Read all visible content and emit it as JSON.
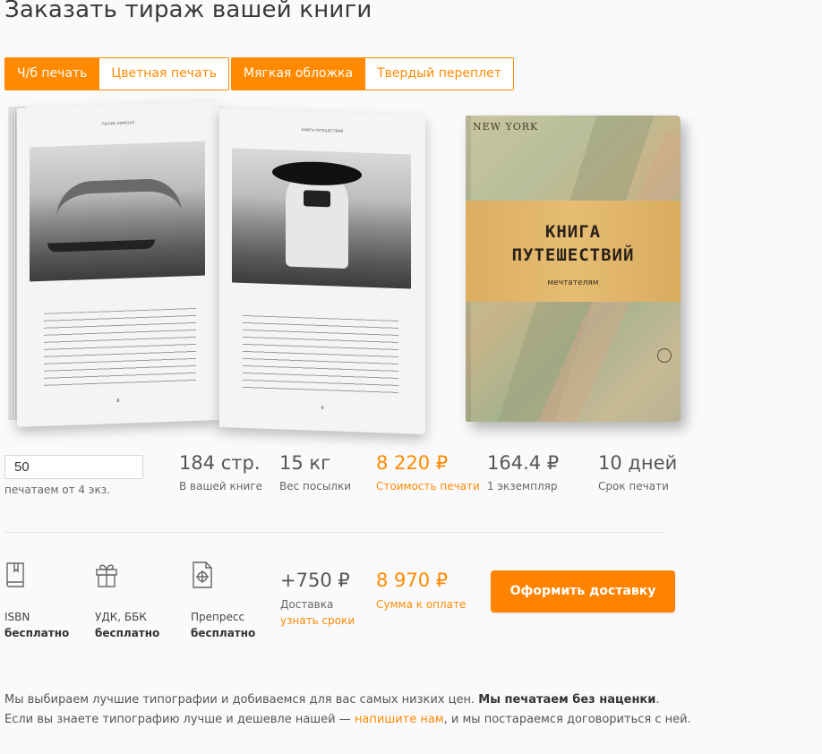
{
  "page_title": "Заказать тираж вашей книги",
  "print_type": {
    "options": [
      "Ч/б печать",
      "Цветная печать"
    ],
    "selected": "Ч/б печать"
  },
  "binding_type": {
    "options": [
      "Мягкая обложка",
      "Твердый переплет"
    ],
    "selected": "Мягкая обложка"
  },
  "preview": {
    "cover_title_line1": "КНИГА",
    "cover_title_line2": "ПУТЕШЕСТВИЙ",
    "cover_subtitle": "мечтателям",
    "cover_map_text": "NEW YORK",
    "left_running_head": "ЛЬЮИС КЭРРОЛЛ",
    "right_running_head": "КНИГА ПУТЕШЕСТВИЙ",
    "left_page_number": "8",
    "right_page_number": "9"
  },
  "quantity": {
    "value": "50",
    "note": "печатаем от 4 экз."
  },
  "stats": [
    {
      "value": "184 стр.",
      "label": "В вашей книге"
    },
    {
      "value": "15 кг",
      "label": "Вес посылки"
    },
    {
      "value": "8 220 ₽",
      "label": "Стоимость печати",
      "accent": true
    },
    {
      "value": "164.4 ₽",
      "label": "1 экземпляр"
    },
    {
      "value": "10 дней",
      "label": "Срок печати"
    }
  ],
  "services": [
    {
      "icon": "book-icon",
      "label": "ISBN",
      "price": "бесплатно"
    },
    {
      "icon": "gift-icon",
      "label": "УДК, ББК",
      "price": "бесплатно"
    },
    {
      "icon": "document-target-icon",
      "label": "Препресс",
      "price": "бесплатно"
    }
  ],
  "delivery": {
    "value": "+750 ₽",
    "label": "Доставка",
    "link": "узнать сроки"
  },
  "total": {
    "value": "8 970 ₽",
    "label": "Сумма к оплате"
  },
  "order_button": "Оформить доставку",
  "footer": {
    "line1_text": "Мы выбираем лучшие типографии и добиваемся для вас самых низких цен. ",
    "line1_bold": "Мы печатаем без наценки",
    "line1_end": ".",
    "line2_text": "Если вы знаете типографию лучше и дешевле нашей — ",
    "line2_link": "напишите нам",
    "line2_end": ", и мы постараемся договориться с ней."
  },
  "colors": {
    "accent": "#ff8a00",
    "button": "#ff8200",
    "text": "#555555"
  }
}
